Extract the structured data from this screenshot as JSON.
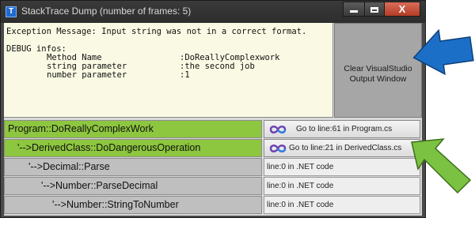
{
  "window": {
    "title": "StackTrace Dump  (number of frames: 5)",
    "app_icon_glyph": "T",
    "controls": {
      "minimize_icon": "minimize-icon",
      "maximize_icon": "maximize-icon",
      "close_label": "X"
    }
  },
  "exception": {
    "message_line": "Exception Message: Input string was not in a correct format.",
    "debug_header": "DEBUG infos:",
    "infos": [
      {
        "name": "Method Name",
        "value": ":DoReallyComplexwork"
      },
      {
        "name": "string parameter",
        "value": ":the second job"
      },
      {
        "name": "number parameter",
        "value": ":1"
      }
    ]
  },
  "clear_button": {
    "line1": "Clear VisualStudio",
    "line2": "Output Window"
  },
  "frames": [
    {
      "label": "Program::DoReallyComplexWork",
      "goto": "Go to line:61 in Program.cs",
      "has_source": true
    },
    {
      "label": "'-->DerivedClass::DoDangerousOperation",
      "goto": "Go to line:21 in DerivedClass.cs",
      "has_source": true
    },
    {
      "label": "'-->Decimal::Parse",
      "goto": "line:0 in .NET code",
      "has_source": false
    },
    {
      "label": "'-->Number::ParseDecimal",
      "goto": "line:0 in .NET code",
      "has_source": false
    },
    {
      "label": "'-->Number::StringToNumber",
      "goto": "line:0 in .NET code",
      "has_source": false
    }
  ],
  "colors": {
    "user_frame": "#8dc63f",
    "system_frame": "#bfbfbf",
    "exception_bg": "#fafae4",
    "arrow_blue": "#1b6fc6",
    "arrow_green": "#7cc242"
  },
  "icons": {
    "visual_studio": "visual-studio-icon",
    "annotation_arrow_blue": "blue-arrow-icon",
    "annotation_arrow_green": "green-arrow-icon"
  }
}
